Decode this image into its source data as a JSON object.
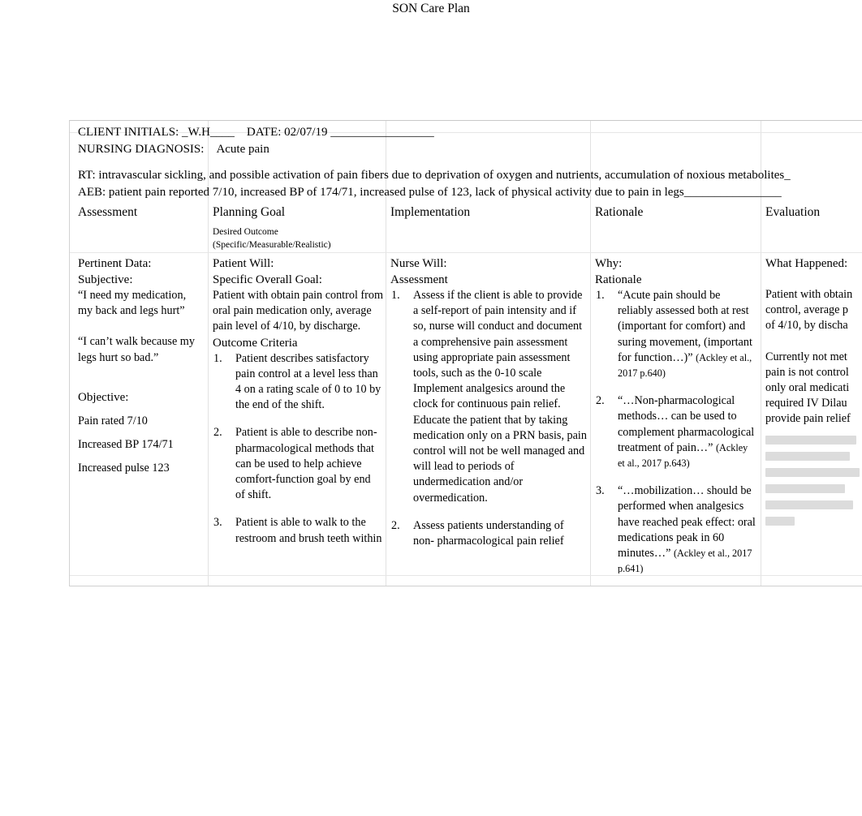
{
  "document": {
    "title": "SON Care Plan"
  },
  "diagnosis": {
    "client_initials_label": "CLIENT INITIALS: _W.H____",
    "date_label": "DATE: 02/07/19 _________________",
    "nursing_diagnosis_label": "NURSING DIAGNOSIS:",
    "nursing_diagnosis_value": "Acute pain",
    "rt_line": "RT: intravascular sickling, and possible activation of pain fibers due to deprivation of oxygen and nutrients, accumulation of noxious metabolites_",
    "aeb_line": "AEB:  patient pain reported 7/10, increased BP of 174/71, increased pulse of 123, lack of physical activity due to pain in legs________________"
  },
  "columns": {
    "assessment": {
      "heading": "Assessment",
      "subheading": "",
      "prompt_1": "Pertinent Data:",
      "prompt_2": "Subjective:",
      "quote_1": "“I need my medication, my back and legs hurt”",
      "quote_2": "“I can’t walk because my legs hurt so bad.”",
      "objective_label": "Objective:",
      "objective_items": [
        "Pain rated 7/10",
        "Increased BP 174/71",
        "Increased pulse 123"
      ]
    },
    "planning_goal": {
      "heading": "Planning Goal",
      "sub_1": "Desired Outcome",
      "sub_2": "(Specific/Measurable/Realistic)",
      "prompt_1": "Patient Will:",
      "prompt_2": "Specific Overall  Goal:",
      "goal_text": "Patient with obtain pain control from oral pain medication only, average pain level of 4/10, by discharge.",
      "criteria_label": "Outcome Criteria",
      "criteria": [
        "Patient describes satisfactory pain control at a level less than 4 on a rating scale of 0 to 10 by the end of the shift.",
        "Patient is able to describe non-pharmacological methods that can be used to help achieve comfort-function goal by end of shift.",
        "Patient is able to walk to the restroom and brush teeth within"
      ]
    },
    "implementation": {
      "heading": "Implementation",
      "prompt_1": "Nurse Will:",
      "prompt_2": "Assessment",
      "interventions": [
        "Assess if the client is able to provide a self-report of pain intensity and if so, nurse will conduct and document a comprehensive pain assessment using appropriate pain assessment tools, such as the 0-10 scale Implement analgesics around the clock for continuous pain relief. Educate the patient that by taking medication only on a PRN basis, pain control will not be well managed and will lead to periods of undermedication and/or overmedication.",
        "Assess patients understanding of non- pharmacological pain relief"
      ]
    },
    "rationale": {
      "heading": "Rationale",
      "prompt_1": "Why:",
      "prompt_2": "Rationale",
      "items": [
        {
          "quote": "“Acute pain should be reliably assessed both at rest (important for comfort) and suring movement, (important for function…)” ",
          "citation": "(Ackley et al., 2017 p.640)"
        },
        {
          "quote": "“…Non-pharmacological methods… can be used to complement pharmacological treatment of pain…” ",
          "citation": "(Ackley et al., 2017 p.643)"
        },
        {
          "quote": "“…mobilization… should be performed when analgesics have reached peak effect: oral medications peak in 60 minutes…” ",
          "citation": "(Ackley et al., 2017 p.641)"
        }
      ]
    },
    "evaluation": {
      "heading": "Evaluation",
      "prompt_1": "What Happened:",
      "goal_restatement_lines": [
        "Patient with obtain",
        "control, average p",
        "of 4/10, by discha"
      ],
      "outcome_lines": [
        "Currently not met",
        "pain is not control",
        "only oral medicati",
        "required IV Dilau",
        "provide pain relief"
      ]
    }
  }
}
